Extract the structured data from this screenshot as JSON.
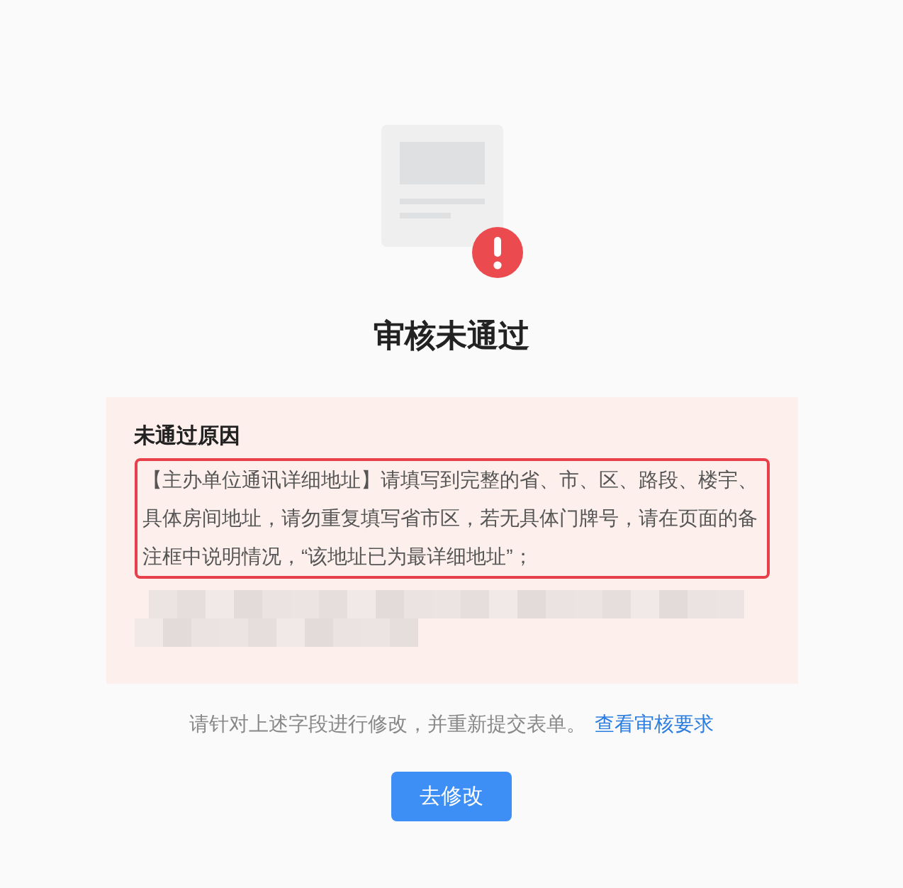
{
  "status": {
    "title": "审核未通过"
  },
  "reason_card": {
    "heading": "未通过原因",
    "reasons": [
      {
        "text": "【主办单位通讯详细地址】请填写到完整的省、市、区、路段、楼宇、具体房间地址，请勿重复填写省市区，若无具体门牌号，请在页面的备注框中说明情况，“该地址已为最详细地址”；",
        "highlighted": true
      },
      {
        "kind": "pixelated"
      }
    ]
  },
  "hint": {
    "text": "请针对上述字段进行修改，并重新提交表单。",
    "link": "查看审核要求"
  },
  "buttons": [
    "去修改"
  ]
}
